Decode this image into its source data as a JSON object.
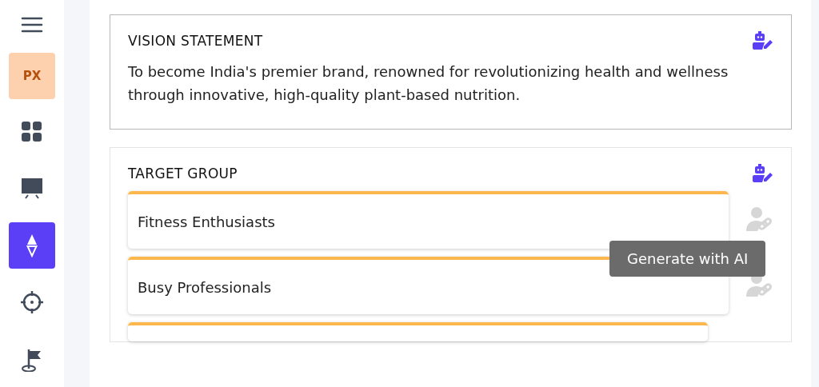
{
  "sidebar": {
    "items": [
      {
        "kind": "menu",
        "selected": false
      },
      {
        "kind": "badge",
        "label": "PX",
        "selected": false
      },
      {
        "kind": "grid",
        "selected": false
      },
      {
        "kind": "board",
        "selected": false
      },
      {
        "kind": "diamond",
        "selected": true
      },
      {
        "kind": "target",
        "selected": false
      },
      {
        "kind": "flag",
        "selected": false
      }
    ]
  },
  "vision": {
    "title": "VISION STATEMENT",
    "text": "To become India's premier brand, renowned for revolutionizing health and wellness through innovative, high-quality plant-based nutrition."
  },
  "target_group": {
    "title": "TARGET GROUP",
    "items": [
      {
        "label": "Fitness Enthusiasts"
      },
      {
        "label": "Busy Professionals"
      }
    ]
  },
  "tooltip": "Generate with AI"
}
